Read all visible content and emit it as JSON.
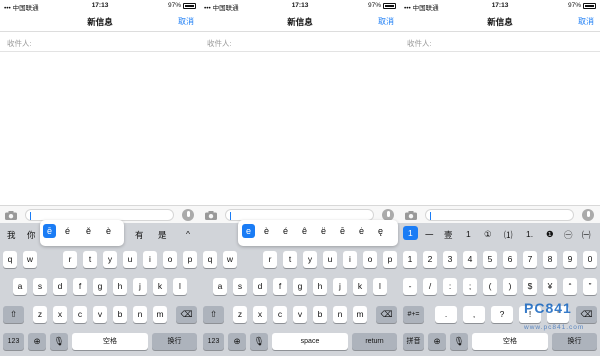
{
  "status": {
    "carrier": "••• 中国联通",
    "time": "17:13",
    "battery": "97%"
  },
  "nav": {
    "title": "新信息",
    "cancel": "取消"
  },
  "recipient_label": "收件人:",
  "panel1": {
    "candidates": [
      "我",
      "你",
      "有",
      "是"
    ],
    "popup": [
      "ē",
      "é",
      "ě",
      "è"
    ],
    "popup_selected": "ē",
    "collapse": "^",
    "rows": [
      [
        "q",
        "w",
        "e",
        "r",
        "t",
        "y",
        "u",
        "i",
        "o",
        "p"
      ],
      [
        "a",
        "s",
        "d",
        "f",
        "g",
        "h",
        "j",
        "k",
        "l"
      ],
      [
        "z",
        "x",
        "c",
        "v",
        "b",
        "n",
        "m"
      ]
    ],
    "num_key": "123",
    "space": "空格",
    "return": "换行"
  },
  "panel2": {
    "popup": [
      "e",
      "è",
      "é",
      "ê",
      "ë",
      "ē",
      "ė",
      "ę"
    ],
    "popup_selected": "e",
    "rows": [
      [
        "q",
        "w",
        "e",
        "r",
        "t",
        "y",
        "u",
        "i",
        "o",
        "p"
      ],
      [
        "a",
        "s",
        "d",
        "f",
        "g",
        "h",
        "j",
        "k",
        "l"
      ],
      [
        "z",
        "x",
        "c",
        "v",
        "b",
        "n",
        "m"
      ]
    ],
    "num_key": "123",
    "space": "space",
    "return": "return"
  },
  "panel3": {
    "candidates": [
      "1",
      "一",
      "壹",
      "1",
      "①",
      "⑴",
      "1.",
      "❶",
      "㊀",
      "㈠"
    ],
    "candidate_selected": "1",
    "rows": [
      [
        "1",
        "2",
        "3",
        "4",
        "5",
        "6",
        "7",
        "8",
        "9",
        "0"
      ],
      [
        "-",
        "/",
        ":",
        ";",
        "(",
        ")",
        "$",
        "¥",
        "“",
        "”"
      ],
      [
        ".",
        ",",
        "?",
        "!",
        "'"
      ]
    ],
    "sym_key": "#+=",
    "pinyin_key": "拼音",
    "space": "空格",
    "return": "换行"
  },
  "watermark": {
    "brand": "PC841",
    "url": "www.pc841.com"
  },
  "colors": {
    "accent": "#1a7cf5",
    "keyboard_bg": "#d1d4d9",
    "dark_key": "#adb3bc"
  },
  "icons": [
    "camera-icon",
    "microphone-icon",
    "shift-icon",
    "backspace-icon",
    "globe-icon",
    "wifi-icon",
    "battery-icon"
  ]
}
